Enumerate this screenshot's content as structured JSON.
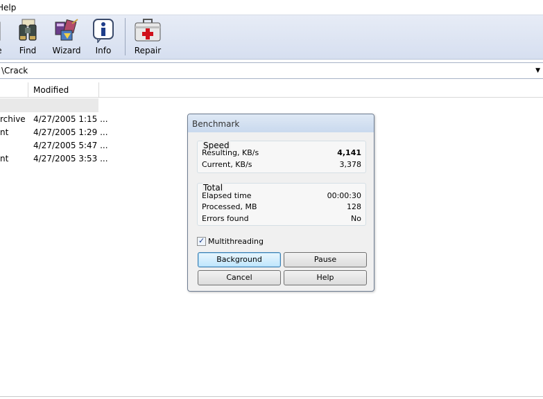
{
  "menubar": {
    "help_label": "Help"
  },
  "toolbar": {
    "items": [
      {
        "label": "e",
        "icon": "partial-icon"
      },
      {
        "label": "Find",
        "icon": "binoculars-icon"
      },
      {
        "label": "Wizard",
        "icon": "wizard-icon"
      },
      {
        "label": "Info",
        "icon": "info-icon"
      },
      {
        "label": "Repair",
        "icon": "first-aid-kit-icon"
      }
    ]
  },
  "address": {
    "path": "\\Crack"
  },
  "filelist": {
    "column_modified": "Modified",
    "rows": [
      {
        "name": "rchive",
        "modified": "4/27/2005 1:15 ..."
      },
      {
        "name": "nt",
        "modified": "4/27/2005 1:29 ..."
      },
      {
        "name": "",
        "modified": "4/27/2005 5:47 ..."
      },
      {
        "name": "nt",
        "modified": "4/27/2005 3:53 ..."
      }
    ]
  },
  "dialog": {
    "title": "Benchmark",
    "speed": {
      "label": "Speed",
      "resulting_label": "Resulting, KB/s",
      "resulting_value": "4,141",
      "current_label": "Current, KB/s",
      "current_value": "3,378"
    },
    "total": {
      "label": "Total",
      "elapsed_label": "Elapsed time",
      "elapsed_value": "00:00:30",
      "processed_label": "Processed, MB",
      "processed_value": "128",
      "errors_label": "Errors found",
      "errors_value": "No"
    },
    "multithreading_label": "Multithreading",
    "multithreading_checked": true,
    "buttons": {
      "background": "Background",
      "pause": "Pause",
      "cancel": "Cancel",
      "help": "Help"
    }
  }
}
